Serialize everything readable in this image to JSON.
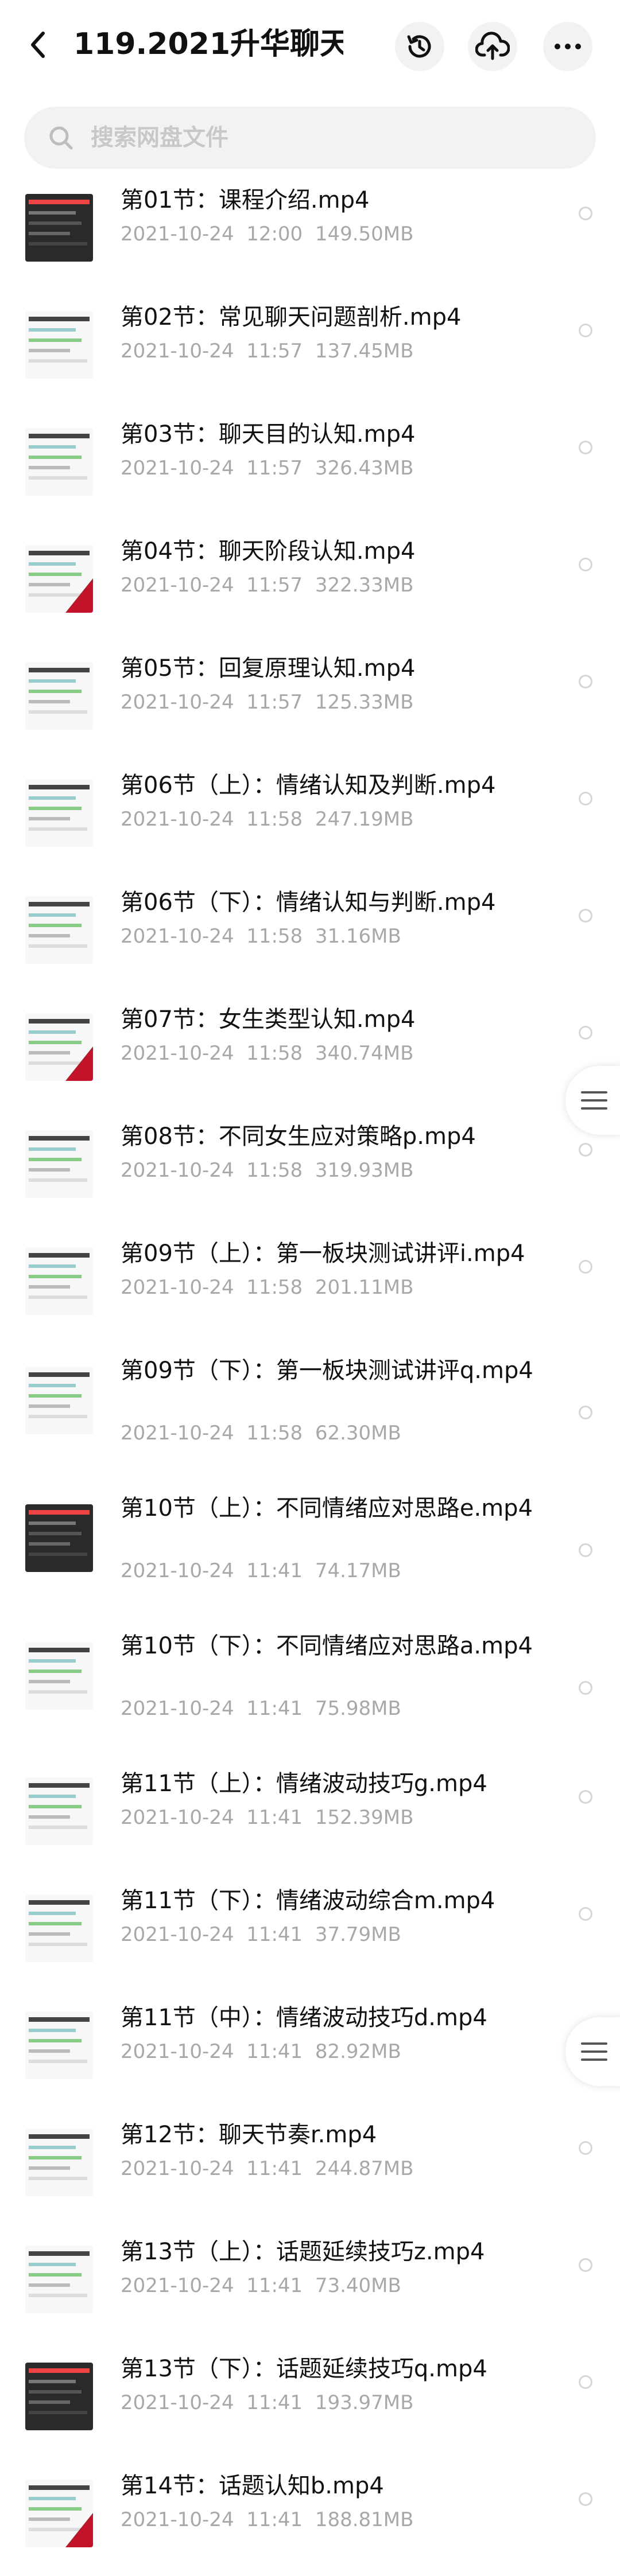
{
  "header": {
    "title": "119.2021升华聊天...",
    "icons": [
      "back-icon",
      "history-icon",
      "cloud-upload-icon",
      "more-icon"
    ]
  },
  "search": {
    "placeholder": "搜索网盘文件"
  },
  "files": [
    {
      "name": "第01节：课程介绍.mp4",
      "date": "2021-10-24  12:00",
      "size": "149.50MB",
      "thumb": "dark"
    },
    {
      "name": "第02节：常见聊天问题剖析.mp4",
      "date": "2021-10-24  11:57",
      "size": "137.45MB",
      "thumb": "light"
    },
    {
      "name": "第03节：聊天目的认知.mp4",
      "date": "2021-10-24  11:57",
      "size": "326.43MB",
      "thumb": "light"
    },
    {
      "name": "第04节：聊天阶段认知.mp4",
      "date": "2021-10-24  11:57",
      "size": "322.33MB",
      "thumb": "red"
    },
    {
      "name": "第05节：回复原理认知.mp4",
      "date": "2021-10-24  11:57",
      "size": "125.33MB",
      "thumb": "light"
    },
    {
      "name": "第06节（上）：情绪认知及判断.mp4",
      "date": "2021-10-24  11:58",
      "size": "247.19MB",
      "thumb": "light"
    },
    {
      "name": "第06节（下）：情绪认知与判断.mp4",
      "date": "2021-10-24  11:58",
      "size": "31.16MB",
      "thumb": "light"
    },
    {
      "name": "第07节：女生类型认知.mp4",
      "date": "2021-10-24  11:58",
      "size": "340.74MB",
      "thumb": "red"
    },
    {
      "name": "第08节：不同女生应对策略p.mp4",
      "date": "2021-10-24  11:58",
      "size": "319.93MB",
      "thumb": "light"
    },
    {
      "name": "第09节（上）：第一板块测试讲评i.mp4",
      "date": "2021-10-24  11:58",
      "size": "201.11MB",
      "thumb": "light"
    },
    {
      "name": "第09节（下）：第一板块测试讲评q.mp4",
      "date": "2021-10-24  11:58",
      "size": "62.30MB",
      "thumb": "light"
    },
    {
      "name": "第10节（上）：不同情绪应对思路e.mp4",
      "date": "2021-10-24  11:41",
      "size": "74.17MB",
      "thumb": "dark"
    },
    {
      "name": "第10节（下）：不同情绪应对思路a.mp4",
      "date": "2021-10-24  11:41",
      "size": "75.98MB",
      "thumb": "light"
    },
    {
      "name": "第11节（上）：情绪波动技巧g.mp4",
      "date": "2021-10-24  11:41",
      "size": "152.39MB",
      "thumb": "light"
    },
    {
      "name": "第11节（下）：情绪波动综合m.mp4",
      "date": "2021-10-24  11:41",
      "size": "37.79MB",
      "thumb": "light"
    },
    {
      "name": "第11节（中）：情绪波动技巧d.mp4",
      "date": "2021-10-24  11:41",
      "size": "82.92MB",
      "thumb": "light"
    },
    {
      "name": "第12节：聊天节奏r.mp4",
      "date": "2021-10-24  11:41",
      "size": "244.87MB",
      "thumb": "light"
    },
    {
      "name": "第13节（上）：话题延续技巧z.mp4",
      "date": "2021-10-24  11:41",
      "size": "73.40MB",
      "thumb": "light"
    },
    {
      "name": "第13节（下）：话题延续技巧q.mp4",
      "date": "2021-10-24  11:41",
      "size": "193.97MB",
      "thumb": "dark"
    },
    {
      "name": "第14节：话题认知b.mp4",
      "date": "2021-10-24  11:41",
      "size": "188.81MB",
      "thumb": "red"
    }
  ]
}
